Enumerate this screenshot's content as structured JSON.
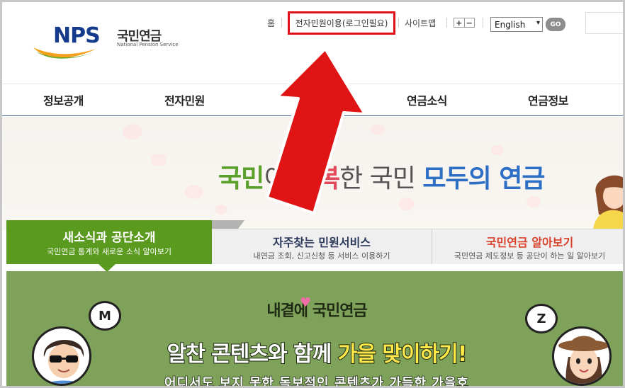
{
  "header": {
    "logo_text": "NPS",
    "logo_korean": "국민연금",
    "logo_english": "National Pension Service",
    "util": {
      "home": "홈",
      "minwon": "전자민원이용(로그인필요)",
      "sitemap": "사이트맵",
      "zoom_in": "+",
      "zoom_out": "−",
      "language": "English",
      "go": "GO"
    }
  },
  "nav": {
    "items": [
      "정보공개",
      "전자민원",
      "",
      "연금소식",
      "연금정보"
    ]
  },
  "hero": {
    "slogan_part1": "국민",
    "slogan_part2": "이 ",
    "slogan_part3": "행복",
    "slogan_part4": "한 국민 ",
    "slogan_part5": "모두의 연금"
  },
  "tabs": [
    {
      "title": "새소식과 공단소개",
      "desc": "국민연금 통계와 새로운 소식 알아보기",
      "active": true
    },
    {
      "title": "자주찾는 민원서비스",
      "desc": "내연금 조회, 신고신청 등 서비스 이용하기",
      "active": false
    },
    {
      "title": "국민연금 알아보기",
      "desc": "국민연금 제도정보 등 공단이 하는 일 알아보기",
      "active": false
    }
  ],
  "banner": {
    "subtitle": "내곁에 국민연금",
    "headline_part1": "알찬 콘텐츠와 함께 ",
    "headline_part2": "가을 맞이하기!",
    "cut_line": "어디서도 보지 못한 독보적인 콘텐츠가 가득한 가을호",
    "bubble_left": "M",
    "bubble_right": "Z"
  },
  "colors": {
    "brand_navy": "#163b8c",
    "brand_green": "#5a9a1e",
    "highlight_red": "#e0101a",
    "banner_green": "#7fa25a"
  },
  "icons": {
    "arrow": "red-up-arrow-icon",
    "zoom_in": "plus-icon",
    "zoom_out": "minus-icon",
    "dropdown": "chevron-down-icon"
  }
}
